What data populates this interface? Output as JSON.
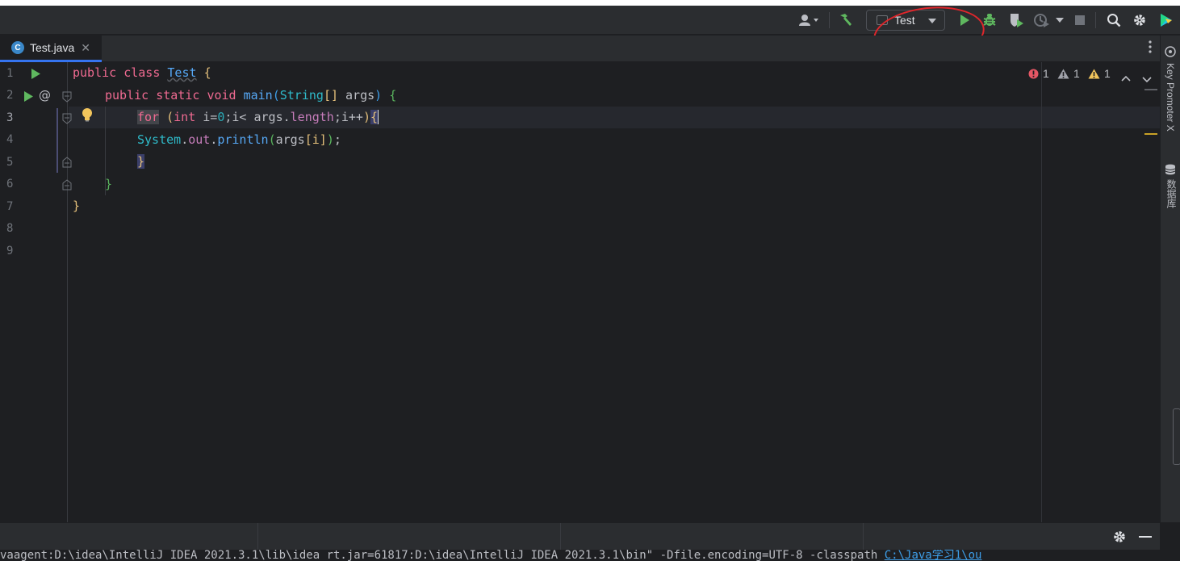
{
  "toolbar": {
    "run_config_label": "Test",
    "icons": [
      "user-icon",
      "build-hammer-icon",
      "run-icon",
      "debug-icon",
      "coverage-icon",
      "profile-icon",
      "stop-icon",
      "search-icon",
      "settings-icon",
      "jetbrains-logo-icon"
    ]
  },
  "tabs": [
    {
      "label": "Test.java",
      "icon": "java-class-icon",
      "active": true
    }
  ],
  "editor": {
    "line_numbers": [
      "1",
      "2",
      "3",
      "4",
      "5",
      "6",
      "7",
      "8",
      "9"
    ],
    "active_line": "3",
    "inspections": {
      "errors": "1",
      "warnings": "1",
      "weak_warnings": "1"
    },
    "code": {
      "l1": {
        "kw_public": "public",
        "kw_class": "class",
        "name": "Test",
        "brace": "{"
      },
      "l2": {
        "kw_public": "public",
        "kw_static": "static",
        "kw_void": "void",
        "name": "main",
        "paren_open": "(",
        "type": "String",
        "arr": "[]",
        "arg": "args",
        "paren_close": ")",
        "brace": "{"
      },
      "l3": {
        "kw_for": "for",
        "paren_open": "(",
        "kw_int": "int",
        "init": "i=",
        "zero": "0",
        "mid": ";i< args.",
        "field": "length",
        "tail": ";i++",
        "paren_close": ")",
        "brace": "{"
      },
      "l4": {
        "sys": "System",
        "dot1": ".",
        "out": "out",
        "dot2": ".",
        "method": "println",
        "paren_open": "(",
        "args": "args",
        "idx": "[i]",
        "paren_close": ")",
        "semi": ";"
      },
      "l5": {
        "brace": "}"
      },
      "l6": {
        "brace": "}"
      },
      "l7": {
        "brace": "}"
      }
    }
  },
  "right_panel": {
    "key_promoter": "Key Promoter X",
    "database": "数据库"
  },
  "console": {
    "prefix": "vaagent:D:\\idea\\IntelliJ IDEA 2021.3.1\\lib\\idea_rt.jar=61817:D:\\idea\\IntelliJ IDEA 2021.3.1\\bin\" -Dfile.encoding=UTF-8 -classpath ",
    "path": "C:\\Java学习1\\ou"
  },
  "colors": {
    "accent": "#3574f0",
    "run_green": "#5fb85f",
    "error_red": "#e55765",
    "warning_yellow": "#f2c55c",
    "annotation_red": "#e0262b"
  }
}
